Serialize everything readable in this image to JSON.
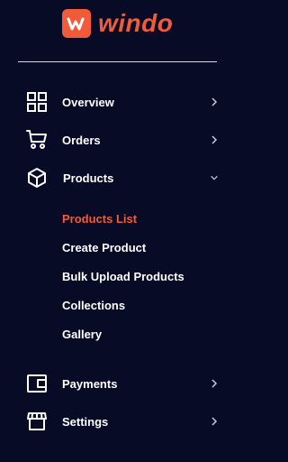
{
  "brand": {
    "name": "windo",
    "accent_color": "#f15b3a",
    "logo_letter": "w"
  },
  "sidebar": {
    "background": "#070b25",
    "items": [
      {
        "label": "Overview",
        "icon": "grid-icon",
        "arrow": "chevron-right-icon"
      },
      {
        "label": "Orders",
        "icon": "cart-icon",
        "arrow": "chevron-right-icon"
      },
      {
        "label": "Products",
        "icon": "box-icon",
        "arrow": "chevron-down-icon",
        "expanded": true
      },
      {
        "label": "Payments",
        "icon": "wallet-icon",
        "arrow": "chevron-right-icon"
      },
      {
        "label": "Settings",
        "icon": "store-icon",
        "arrow": "chevron-right-icon"
      }
    ],
    "products_submenu": [
      {
        "label": "Products List",
        "active": true
      },
      {
        "label": "Create Product",
        "active": false
      },
      {
        "label": "Bulk Upload Products",
        "active": false
      },
      {
        "label": "Collections",
        "active": false
      },
      {
        "label": "Gallery",
        "active": false
      }
    ]
  }
}
